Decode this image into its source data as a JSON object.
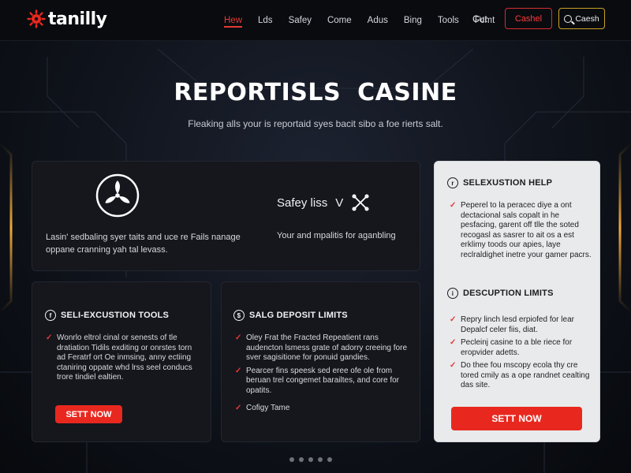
{
  "brand": {
    "name": "tanilly"
  },
  "nav": {
    "links": [
      "Hew",
      "Lds",
      "Safey",
      "Come",
      "Adus",
      "Bing",
      "Tools",
      "Fcmt"
    ],
    "extra": "Cut",
    "cta": "Cashel",
    "search": "Caesh"
  },
  "hero": {
    "title": "REPORTISLS CASINE",
    "subtitle": "Fleaking alls your is reportaid syes bacit sibo a foe rierts salt."
  },
  "top_card": {
    "left_text": "Lasin' sedbaling syer taits and uce re Fails nanage oppane cranning yah tal levass.",
    "right_label": "Safey liss",
    "right_letter": "V",
    "right_text": "Your and mpalitis for aganbling"
  },
  "card_tools": {
    "title": "SELI-EXCUSTION TOOLS",
    "bullets": [
      "Wonrlo eltrol cinal or senests of tle dratiation Tidils exditing or onrstes torn ad Feratrf ort Oe inmsing, anny ectiing ctaniring oppate whd lrss seel conducs trore tindiel ealtien."
    ],
    "button": "SETT NOW"
  },
  "card_deposit": {
    "title": "SALG DEPOSIT LIMITS",
    "bullets": [
      "Oley Frat the Fracted Repeatient rans audencton lsmess grate of adorry creeing fore sver sagisitione for ponuid gandies.",
      "Pearcer fins speesk sed eree ofe ole from beruan trel congemet barailtes, and core for opatits.",
      "Cofigy Tame"
    ]
  },
  "card_help": {
    "title": "SELEXUSTION HELP",
    "bullets": [
      "Peperel to la peracec diye a ont dectacional sals copalt in he pesfacing, garent off tlle the soted recogasl as sasrer to ait os a est erklimy toods our apies, laye reclraldighet inetre your gamer pacrs."
    ],
    "subtitle": "DESCUPTION LIMITS",
    "bullets2": [
      "Repry linch lesd erpiofed for lear Depalcf celer fiis, diat.",
      "Pecleinj casine to a ble riece for eropvider adetts.",
      "Do thee fou mscopy ecola thy cre tored cmily as a ope randnet cealting das site."
    ],
    "button": "SETT NOW"
  },
  "pager": {
    "count": 5
  },
  "colors": {
    "accent": "#e8281f",
    "gold": "#c9a227",
    "bg": "#0b0d12"
  }
}
